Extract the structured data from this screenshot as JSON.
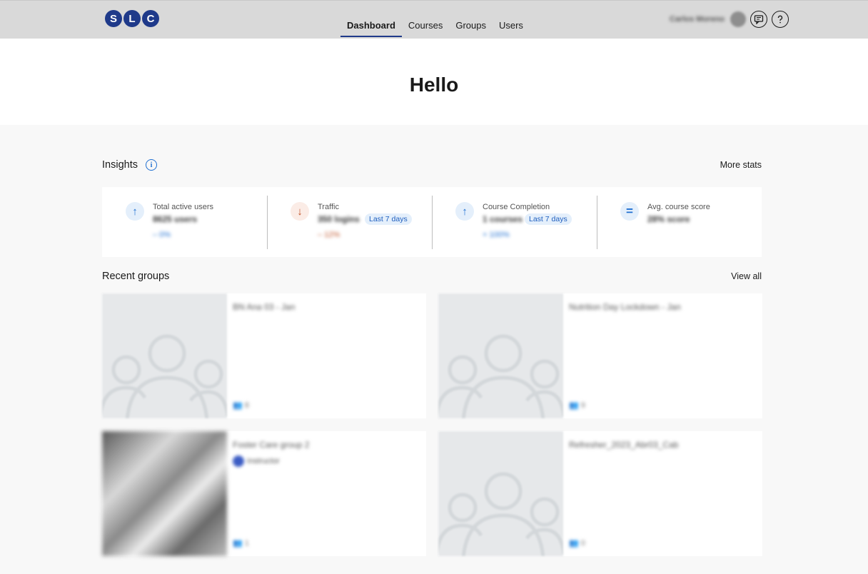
{
  "brand": {
    "letters": [
      "S",
      "L",
      "C"
    ],
    "color": "#1f3a8a"
  },
  "nav": {
    "items": [
      "Dashboard",
      "Courses",
      "Groups",
      "Users"
    ],
    "active": "Dashboard"
  },
  "header": {
    "username": "Carlos Moreno"
  },
  "hero": {
    "greeting": "Hello"
  },
  "insights": {
    "title": "Insights",
    "more_link": "More stats",
    "stats": [
      {
        "label": "Total active users",
        "value": "8625 users",
        "delta": "– 0%",
        "trend": "up",
        "icon": "arrow-up-icon"
      },
      {
        "label": "Traffic",
        "value": "350 logins",
        "chip": "Last 7 days",
        "delta": "– 12%",
        "trend": "down",
        "icon": "arrow-down-icon"
      },
      {
        "label": "Course Completion",
        "value": "1 courses",
        "chip": "Last 7 days",
        "delta": "+ 100%",
        "trend": "up",
        "icon": "arrow-up-icon"
      },
      {
        "label": "Avg. course score",
        "value": "28% score",
        "trend": "flat",
        "icon": "equals-icon"
      }
    ]
  },
  "recent_groups": {
    "title": "Recent groups",
    "view_all": "View all",
    "groups": [
      {
        "name": "BN Ana 03 - Jan",
        "members": "8",
        "thumb": "placeholder"
      },
      {
        "name": "Nutrition Day Lockdown - Jan",
        "members": "9",
        "thumb": "placeholder"
      },
      {
        "name": "Foster Care group 2",
        "owner": "Instructor",
        "members": "1",
        "thumb": "photo"
      },
      {
        "name": "Refresher_2023_Abr03_Cab",
        "members": "0",
        "thumb": "placeholder"
      }
    ]
  }
}
